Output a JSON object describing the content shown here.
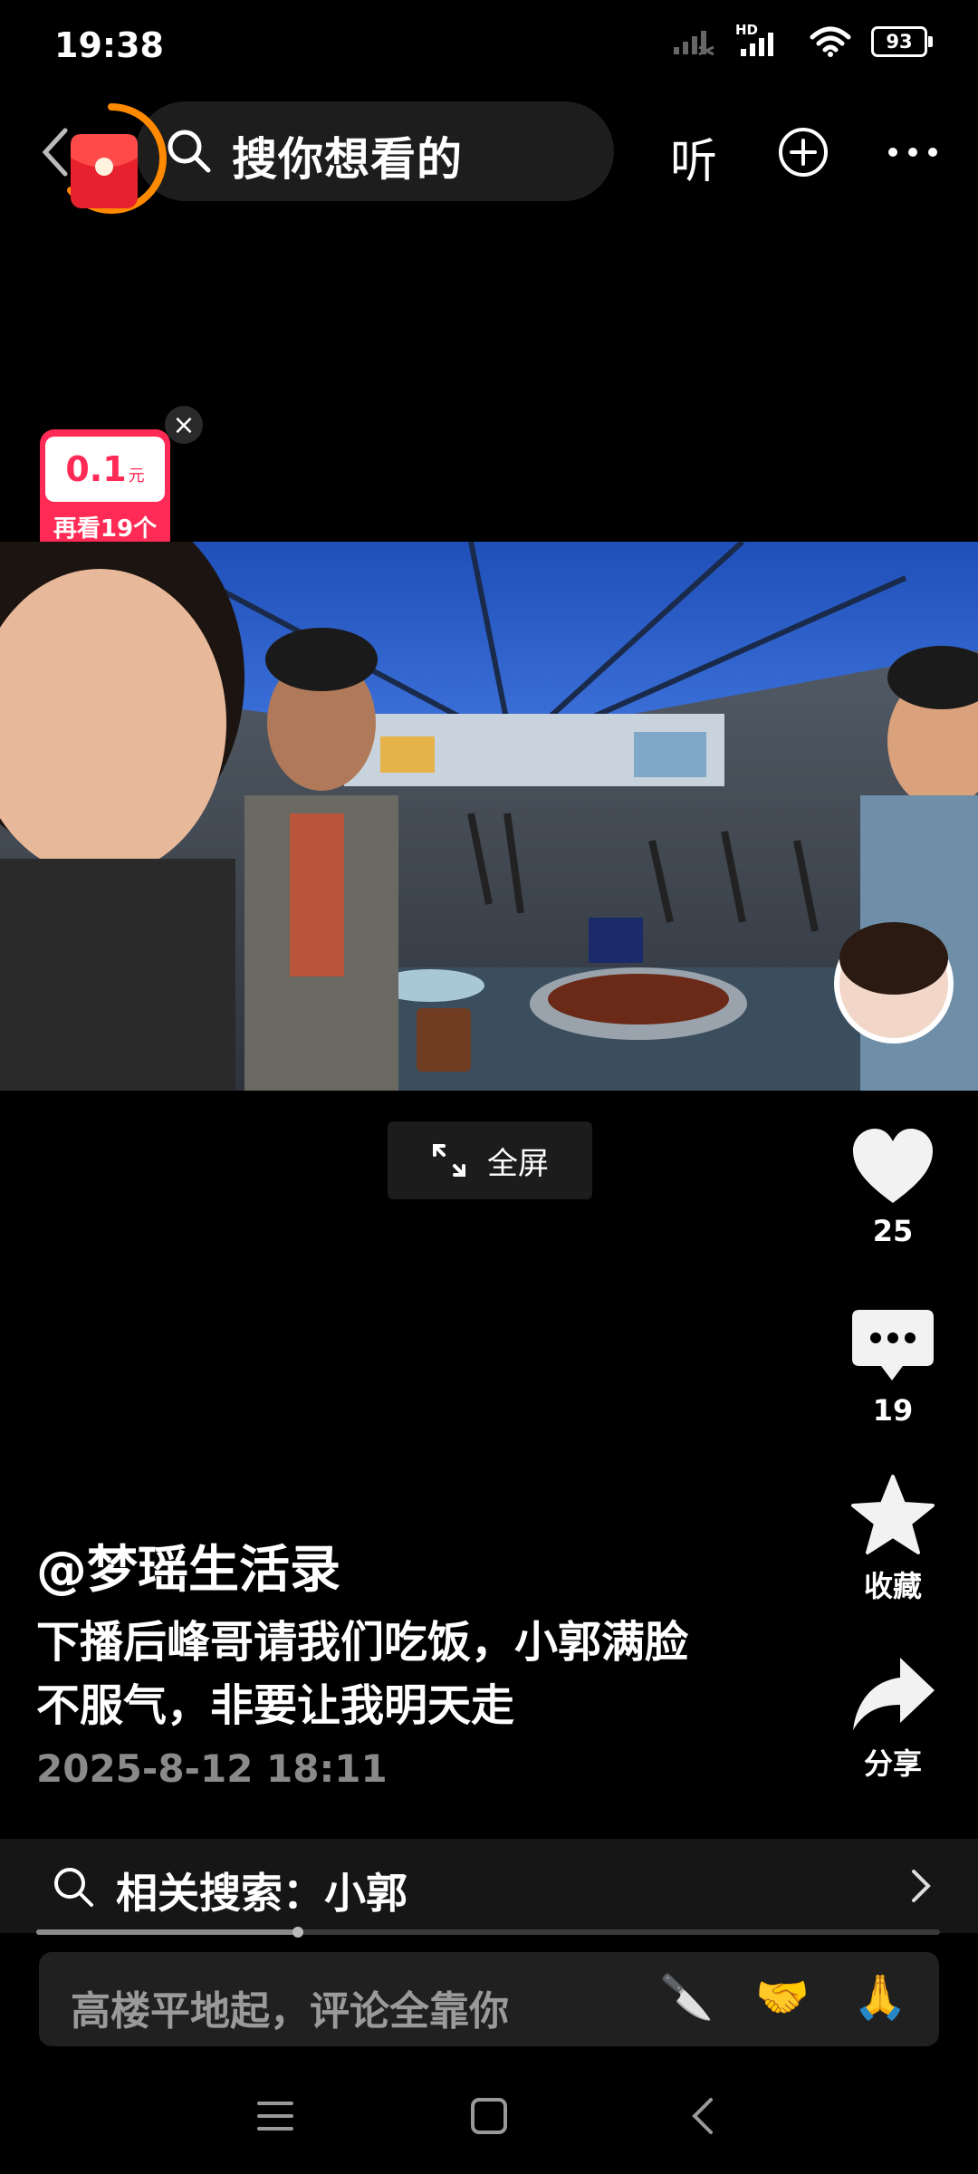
{
  "status_bar": {
    "time": "19:38",
    "network_label": "HD",
    "battery": "93"
  },
  "top_bar": {
    "search_placeholder": "搜你想看的",
    "listen_label": "听"
  },
  "reward": {
    "amount": "0.1",
    "unit": "元",
    "subtitle": "再看19个"
  },
  "video": {
    "fullscreen_label": "全屏"
  },
  "rail": {
    "like_count": "25",
    "comment_count": "19",
    "favorite_label": "收藏",
    "share_label": "分享"
  },
  "post": {
    "author": "@梦瑶生活录",
    "caption_line1": "下播后峰哥请我们吃饭，小郭满脸",
    "caption_line2": "不服气，非要让我明天走",
    "date": "2025-8-12 18:11"
  },
  "related": {
    "label": "相关搜索：小郭"
  },
  "playback": {
    "progress": 0.29
  },
  "comment": {
    "placeholder": "高楼平地起，评论全靠你",
    "emojis": [
      "🔪",
      "🤝",
      "🙏"
    ]
  },
  "colors": {
    "accent_red": "#ff2a55",
    "envelope_red": "#e8212e",
    "ring_orange": "#ff8a00"
  }
}
